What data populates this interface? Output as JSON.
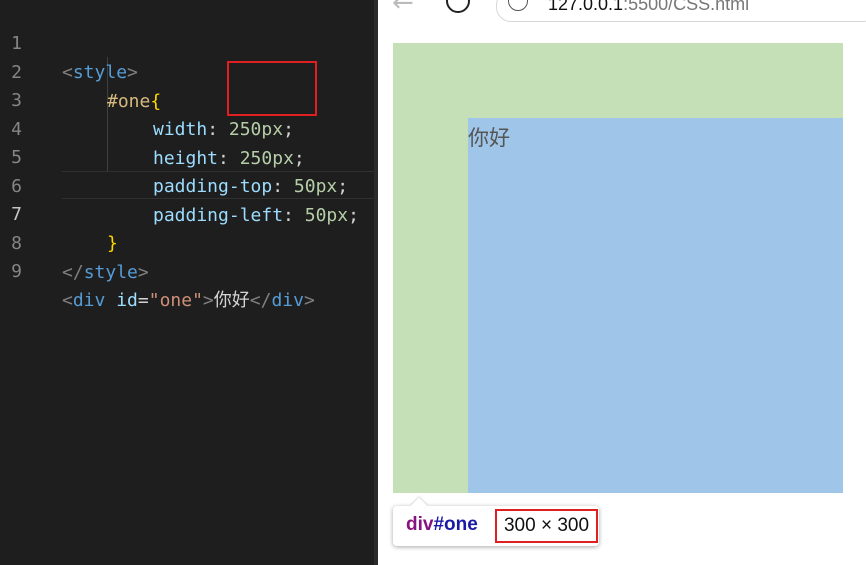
{
  "editor": {
    "line_numbers": [
      "1",
      "2",
      "3",
      "4",
      "5",
      "6",
      "7",
      "8",
      "9"
    ],
    "line1": {
      "open": "<",
      "tag": "style",
      "close": ">"
    },
    "line2": {
      "selector": "#one",
      "brace": "{"
    },
    "line3": {
      "prop": "width",
      "colon": ": ",
      "value": "250px",
      "semi": ";"
    },
    "line4": {
      "prop": "height",
      "colon": ": ",
      "value": "250px",
      "semi": ";"
    },
    "line5": {
      "prop": "padding-top",
      "colon": ": ",
      "value": "50px",
      "semi": ";"
    },
    "line6": {
      "prop": "padding-left",
      "colon": ": ",
      "value": "50px",
      "semi": ";"
    },
    "line7": {
      "brace": "}"
    },
    "line8": {
      "open": "</",
      "tag": "style",
      "close": ">"
    },
    "line9": {
      "open": "<",
      "tag": "div",
      "attr": "id",
      "eq": "=",
      "val": "\"one\"",
      "close": ">",
      "text": "你好",
      "endopen": "</",
      "endtag": "div",
      "endclose": ">"
    }
  },
  "browser": {
    "back_icon": "arrow-left-icon",
    "reload_icon": "reload-icon",
    "info_icon": "info-icon",
    "url_host": "127.0.0.1",
    "url_rest": ":5500/CSS.html",
    "content_text": "你好",
    "tooltip": {
      "tag": "div",
      "id": "#one",
      "size": "300 × 300"
    }
  },
  "colors": {
    "outer_box": "#c5dfb7",
    "inner_box": "#9fc6e8",
    "highlight_box": "#e02020"
  }
}
